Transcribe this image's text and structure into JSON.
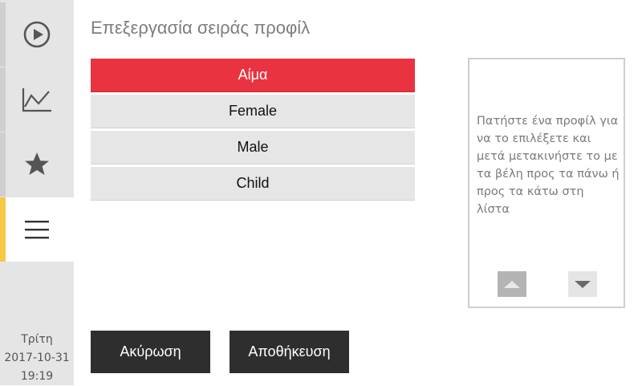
{
  "sidebar": {
    "items": [
      {
        "icon": "play-icon",
        "active": false
      },
      {
        "icon": "chart-line-icon",
        "active": false
      },
      {
        "icon": "star-icon",
        "active": false
      },
      {
        "icon": "menu-icon",
        "active": true
      }
    ],
    "day": "Τρίτη",
    "date": "2017-10-31",
    "time": "19:19"
  },
  "page": {
    "title": "Επεξεργασία σειράς προφίλ"
  },
  "profiles": {
    "items": [
      {
        "label": "Αίμα",
        "selected": true
      },
      {
        "label": "Female",
        "selected": false
      },
      {
        "label": "Male",
        "selected": false
      },
      {
        "label": "Child",
        "selected": false
      }
    ]
  },
  "help": {
    "text": "Πατήστε ένα προφίλ για να το επιλέξετε και μετά μετακινήστε το με τα βέλη προς τα πάνω ή προς τα κάτω στη λίστα"
  },
  "actions": {
    "cancel_label": "Ακύρωση",
    "save_label": "Αποθήκευση"
  },
  "colors": {
    "selected": "#e93340",
    "active_indicator": "#f7c843",
    "button_dark": "#2e2e2e"
  }
}
